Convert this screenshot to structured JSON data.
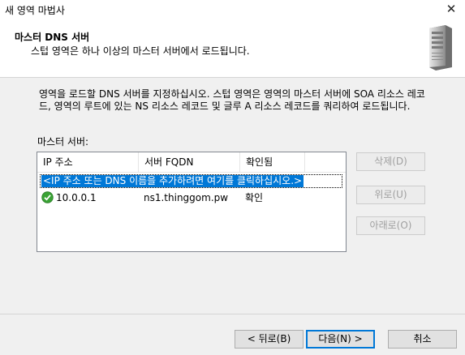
{
  "window": {
    "title": "새 영역 마법사",
    "close_glyph": "✕"
  },
  "header": {
    "title": "마스터 DNS 서버",
    "subtitle": "스텁 영역은 하나 이상의 마스터 서버에서 로드됩니다."
  },
  "description": "영역을 로드할 DNS 서버를 지정하십시오. 스텁 영역은 영역의 마스터 서버에 SOA 리소스 레코드, 영역의 루트에 있는 NS 리소스 레코드 및 글루 A 리소스 레코드를 쿼리하여 로드됩니다.",
  "master_servers": {
    "label": "마스터 서버:",
    "columns": [
      "IP 주소",
      "서버 FQDN",
      "확인됨"
    ],
    "add_prompt": "<IP 주소 또는 DNS 이름을 추가하려면 여기를 클릭하십시오.>",
    "rows": [
      {
        "ip": "10.0.0.1",
        "fqdn": "ns1.thinggom.pw",
        "verified": "확인",
        "status_icon": "green-check-icon"
      }
    ]
  },
  "side_buttons": {
    "delete": "삭제(D)",
    "up": "위로(U)",
    "down": "아래로(O)"
  },
  "footer": {
    "back": "< 뒤로(B)",
    "next": "다음(N) >",
    "cancel": "취소"
  },
  "colors": {
    "selection": "#0078d7",
    "check_green": "#3aa335"
  }
}
